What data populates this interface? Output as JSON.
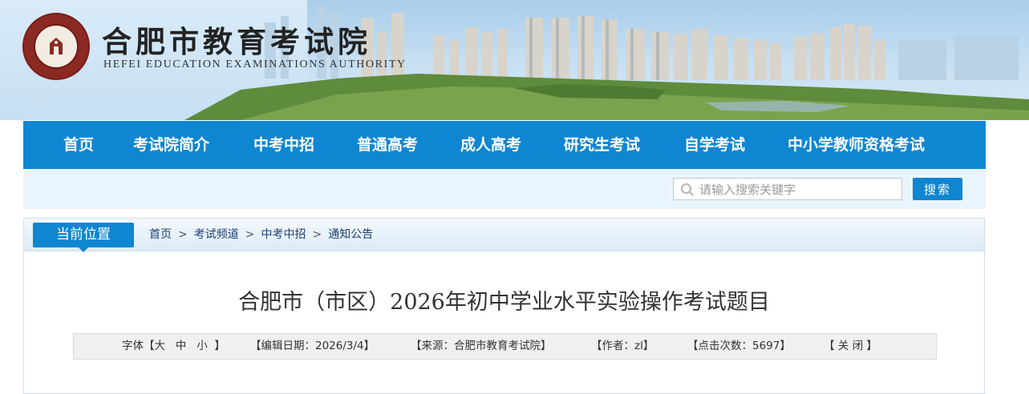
{
  "header": {
    "title": "合肥市教育考试院",
    "subtitle": "HEFEI EDUCATION EXAMINATIONS AUTHORITY",
    "logo_icon": "school-emblem-icon"
  },
  "nav": {
    "items": [
      "首页",
      "考试院简介",
      "中考中招",
      "普通高考",
      "成人高考",
      "研究生考试",
      "自学考试",
      "中小学教师资格考试"
    ]
  },
  "search": {
    "placeholder": "请输入搜索关键字",
    "button_label": "搜索"
  },
  "breadcrumb": {
    "tab_label": "当前位置",
    "items": [
      "首页",
      "考试频道",
      "中考中招",
      "通知公告"
    ],
    "separator": ">"
  },
  "article": {
    "title": "合肥市（市区）2026年初中学业水平实验操作考试题目",
    "font_label": "字体【",
    "font_large": "大",
    "font_medium": "中",
    "font_small": "小",
    "font_close": "】",
    "edit_date": "【编辑日期：2026/3/4】",
    "source": "【来源：合肥市教育考试院】",
    "author": "【作者：zl】",
    "clicks": "【点击次数：5697】",
    "close": "【 关 闭 】"
  },
  "colors": {
    "primary_blue": "#0f86d1",
    "breadcrumb_text": "#1d3f73",
    "logo_red": "#8b2a22"
  }
}
